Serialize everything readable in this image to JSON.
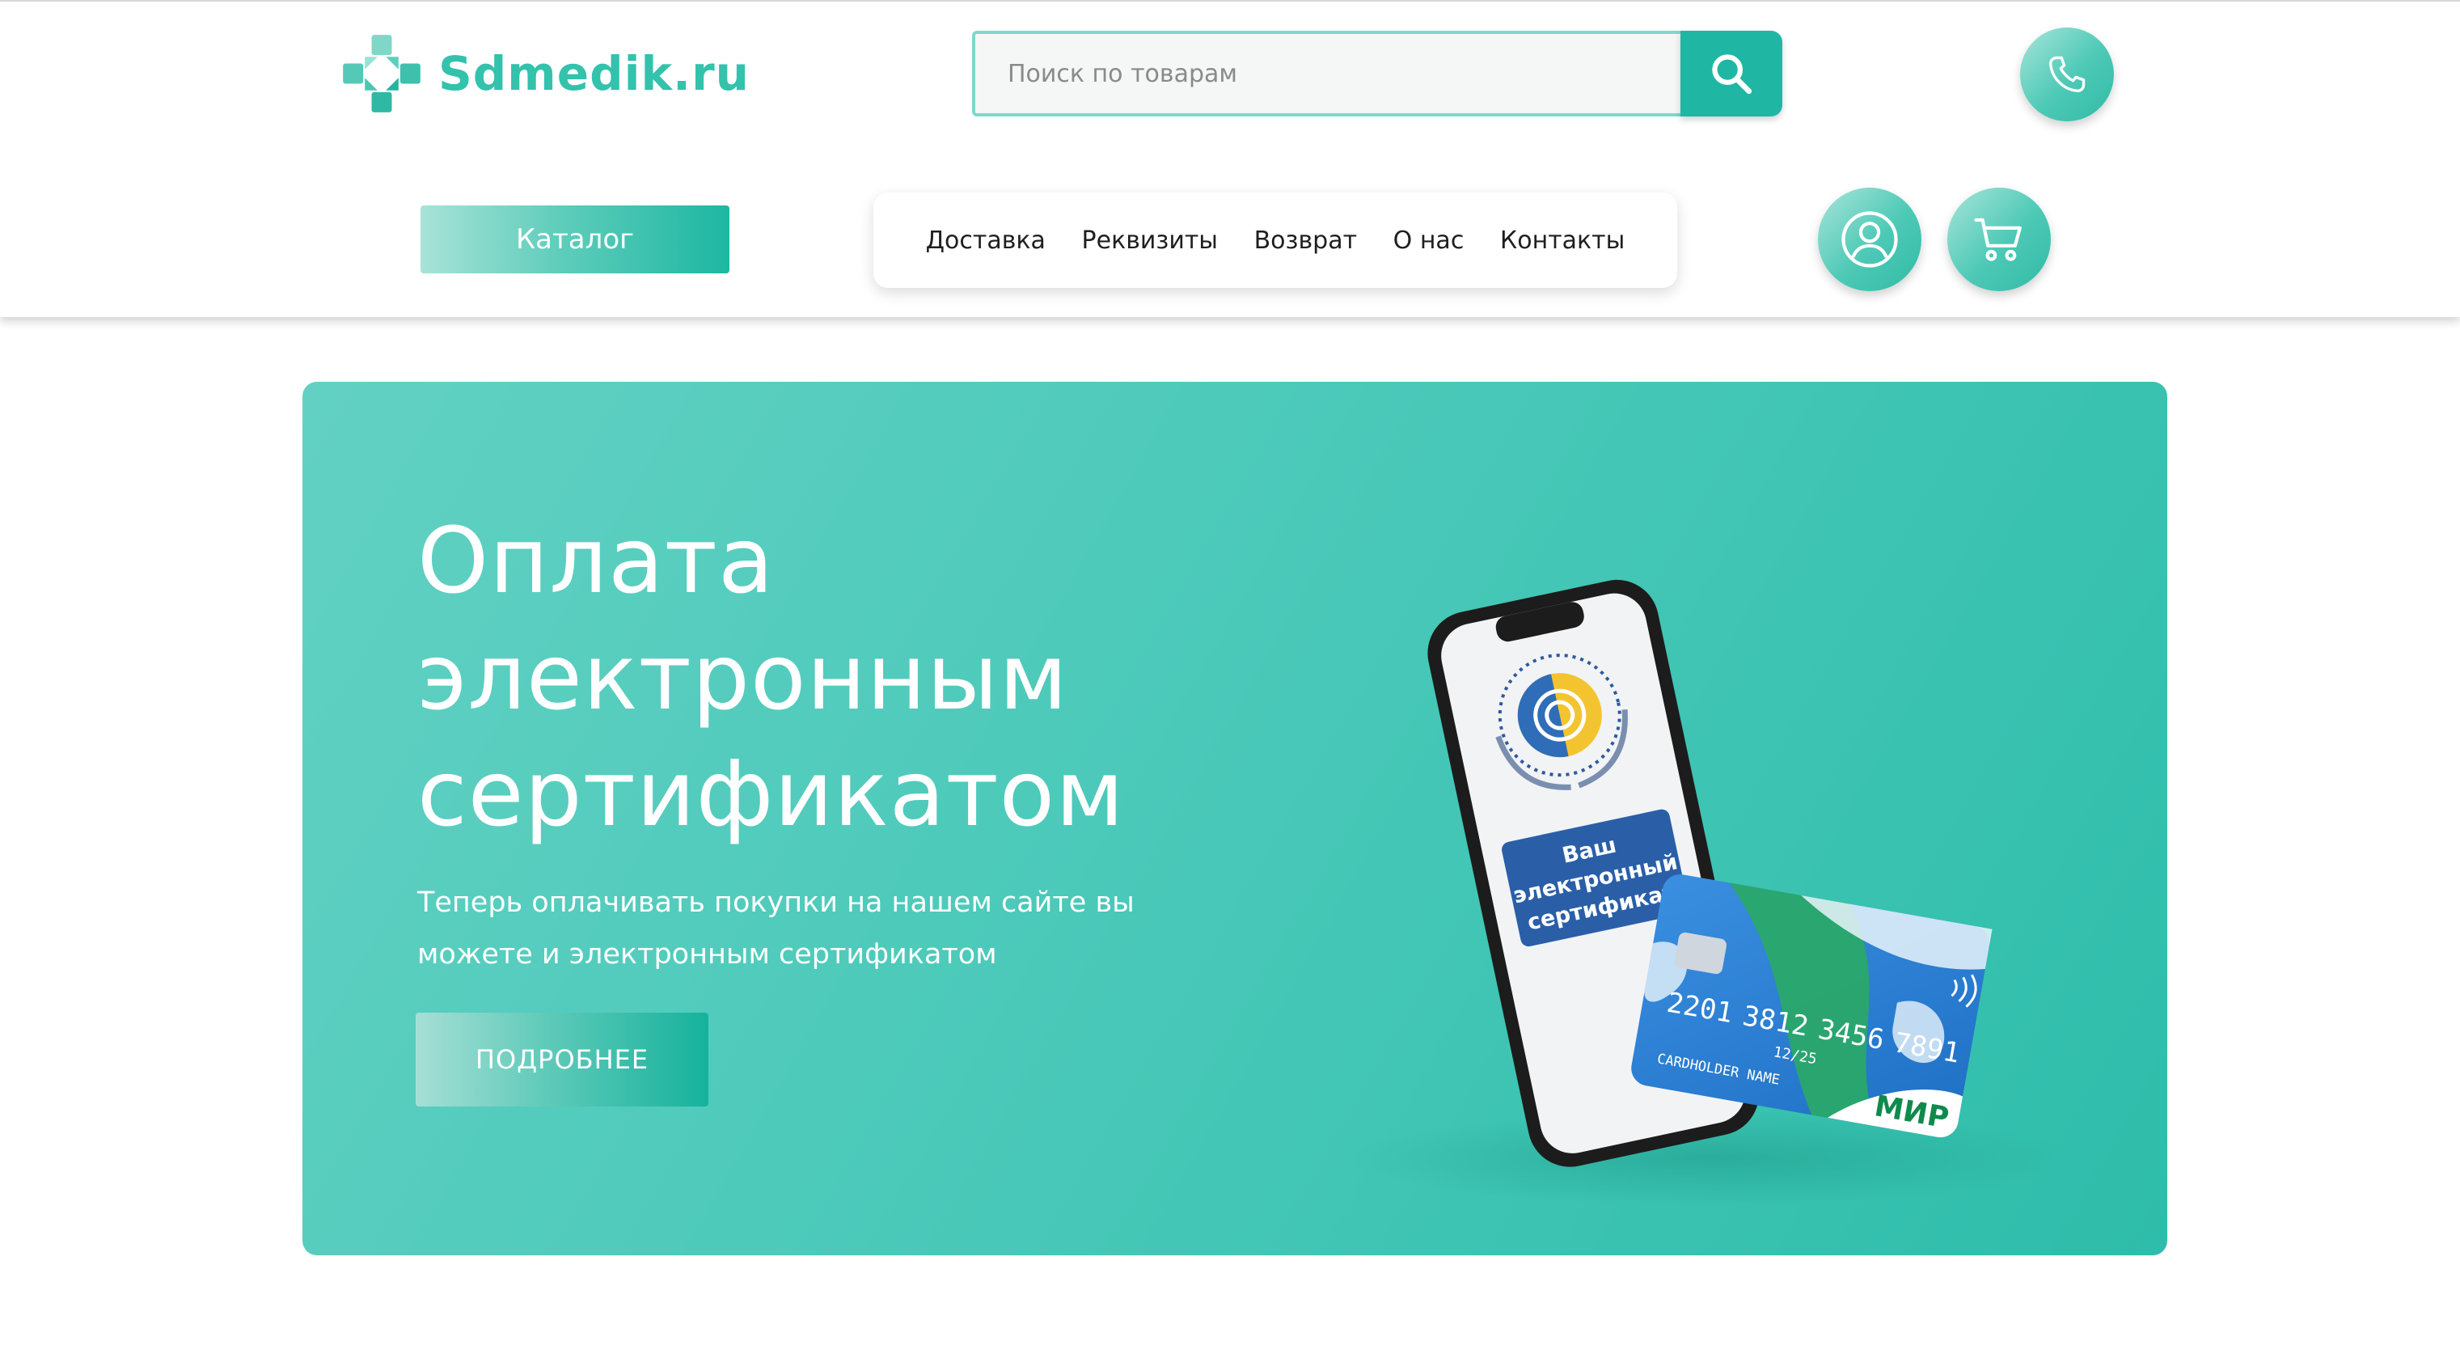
{
  "header": {
    "logo_text": "Sdmedik.ru",
    "search_placeholder": "Поиск по товарам",
    "search_value": "",
    "catalog_label": "Каталог",
    "nav": [
      {
        "label": "Доставка"
      },
      {
        "label": "Реквизиты"
      },
      {
        "label": "Возврат"
      },
      {
        "label": "О нас"
      },
      {
        "label": "Контакты"
      }
    ],
    "icons": {
      "logo": "medical-cross-logo-icon",
      "search": "search-icon",
      "phone": "phone-icon",
      "account": "user-icon",
      "cart": "cart-icon"
    }
  },
  "banner": {
    "title_lines": [
      "Оплата",
      "электронным",
      "сертификатом"
    ],
    "subtitle_lines": [
      "Теперь оплачивать покупки на нашем сайте вы",
      "можете и электронным сертификатом"
    ],
    "button_label": "ПОДРОБНЕЕ",
    "phone_screen_lines": [
      "Ваш",
      "электронный",
      "сертификат"
    ],
    "card": {
      "number_groups": [
        "2201",
        "3812",
        "3456",
        "7891"
      ],
      "expiry": "12/25",
      "holder": "CARDHOLDER NAME",
      "brand": "МИР"
    }
  },
  "colors": {
    "accent": "#1fb7a3",
    "logo": "#33c2ac",
    "banner_from": "#62d1c3",
    "banner_to": "#2ebdaa",
    "card_blue": "#1f7fd0",
    "card_green": "#2aa86a"
  }
}
